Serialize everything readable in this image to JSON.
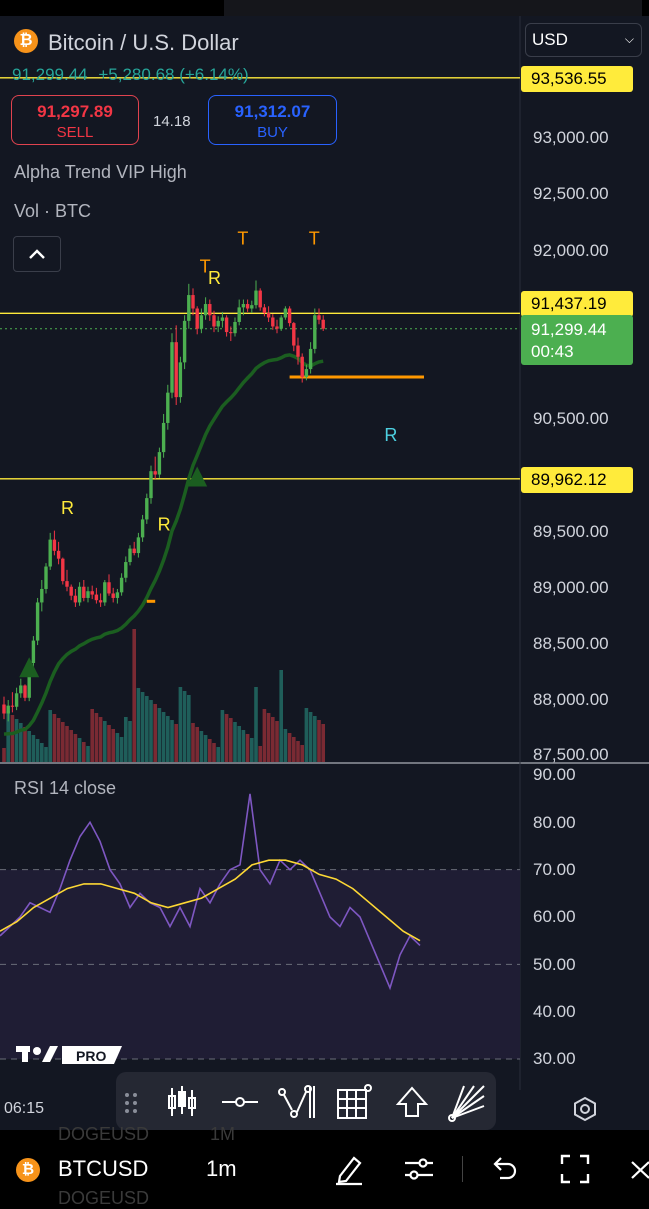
{
  "header": {
    "title": "Bitcoin / U.S. Dollar",
    "last_price": "91,299.44",
    "change": "+5,280.68 (+6.14%)",
    "currency": "USD",
    "logo_glyph": "₿"
  },
  "trade": {
    "sell_price": "91,297.89",
    "sell_label": "SELL",
    "spread": "14.18",
    "buy_price": "91,312.07",
    "buy_label": "BUY"
  },
  "indicators": {
    "alpha_trend": "Alpha Trend VIP High",
    "volume": "Vol · BTC",
    "rsi": "RSI 14 close"
  },
  "price_axis": {
    "tags": {
      "top_line": "93,536.55",
      "mid_line": "91,437.19",
      "low_line": "89,962.12",
      "current": "91,299.44",
      "countdown": "00:43"
    },
    "labels": [
      "93,000.00",
      "92,500.00",
      "92,000.00",
      "90,500.00",
      "89,500.00",
      "89,000.00",
      "88,500.00",
      "88,000.00",
      "87,500.00"
    ]
  },
  "rsi_axis": {
    "labels": [
      "90.00",
      "80.00",
      "70.00",
      "60.00",
      "50.00",
      "40.00",
      "30.00"
    ]
  },
  "time_axis": {
    "first": "06:15"
  },
  "signals": {
    "t": "T",
    "r": "R"
  },
  "branding": {
    "pro": "PRO"
  },
  "bottom_bar": {
    "symbol": "BTCUSD",
    "interval": "1m",
    "ghost_symbol_1": "DOGEUSD",
    "ghost_interval_1": "1M",
    "ghost_symbol_2": "DOGEUSD"
  },
  "colors": {
    "background": "#131722",
    "up": "#4caf50",
    "down": "#f23645",
    "levels": "#ffeb3b",
    "trend": "#1b5e20",
    "signal": "#ff9800",
    "rsi": "#7e57c2",
    "rsi_ma": "#fdd835"
  },
  "chart_data": {
    "type": "candlestick",
    "price_ylim": [
      87500,
      93700
    ],
    "levels": [
      93536.55,
      91437.19,
      89962.12
    ],
    "current": 91299.44,
    "ohlc": [
      [
        87950,
        88020,
        87820,
        87870
      ],
      [
        87870,
        87990,
        87800,
        87940
      ],
      [
        87940,
        88060,
        87880,
        87930
      ],
      [
        87930,
        88100,
        87900,
        88050
      ],
      [
        88050,
        88180,
        88010,
        88120
      ],
      [
        88120,
        88130,
        87980,
        88010
      ],
      [
        88010,
        88350,
        87980,
        88320
      ],
      [
        88320,
        88560,
        88280,
        88520
      ],
      [
        88520,
        88900,
        88480,
        88860
      ],
      [
        88860,
        89060,
        88780,
        88980
      ],
      [
        88980,
        89210,
        88940,
        89180
      ],
      [
        89180,
        89480,
        89150,
        89420
      ],
      [
        89420,
        89500,
        89280,
        89320
      ],
      [
        89320,
        89400,
        89200,
        89250
      ],
      [
        89250,
        89260,
        89020,
        89050
      ],
      [
        89050,
        89150,
        88960,
        89000
      ],
      [
        89000,
        89020,
        88880,
        88920
      ],
      [
        88920,
        88980,
        88820,
        88860
      ],
      [
        88860,
        89040,
        88830,
        89000
      ],
      [
        89000,
        89060,
        88870,
        88900
      ],
      [
        88900,
        89000,
        88860,
        88960
      ],
      [
        88960,
        89010,
        88890,
        88930
      ],
      [
        88930,
        88990,
        88850,
        88880
      ],
      [
        88880,
        88940,
        88820,
        88860
      ],
      [
        88860,
        89060,
        88830,
        89040
      ],
      [
        89040,
        89110,
        88920,
        88940
      ],
      [
        88940,
        88990,
        88860,
        88900
      ],
      [
        88900,
        88980,
        88850,
        88950
      ],
      [
        88950,
        89120,
        88920,
        89080
      ],
      [
        89080,
        89270,
        89040,
        89220
      ],
      [
        89220,
        89370,
        89190,
        89340
      ],
      [
        89340,
        89400,
        89280,
        89300
      ],
      [
        89300,
        89480,
        89260,
        89440
      ],
      [
        89440,
        89640,
        89400,
        89600
      ],
      [
        89600,
        89830,
        89560,
        89790
      ],
      [
        89790,
        90080,
        89740,
        90030
      ],
      [
        90030,
        90160,
        89960,
        90000
      ],
      [
        90000,
        90240,
        89970,
        90200
      ],
      [
        90200,
        90540,
        90150,
        90460
      ],
      [
        90460,
        90800,
        90400,
        90730
      ],
      [
        90730,
        91260,
        90680,
        91180
      ],
      [
        91180,
        91330,
        90620,
        90690
      ],
      [
        90690,
        91050,
        90640,
        91000
      ],
      [
        91000,
        91420,
        90940,
        91370
      ],
      [
        91370,
        91700,
        91300,
        91600
      ],
      [
        91600,
        91660,
        91420,
        91480
      ],
      [
        91480,
        91500,
        91250,
        91300
      ],
      [
        91300,
        91480,
        91260,
        91420
      ],
      [
        91420,
        91580,
        91380,
        91520
      ],
      [
        91520,
        91560,
        91370,
        91420
      ],
      [
        91420,
        91460,
        91270,
        91320
      ],
      [
        91320,
        91410,
        91270,
        91370
      ],
      [
        91370,
        91450,
        91310,
        91400
      ],
      [
        91400,
        91420,
        91230,
        91270
      ],
      [
        91270,
        91320,
        91190,
        91260
      ],
      [
        91260,
        91400,
        91230,
        91360
      ],
      [
        91360,
        91560,
        91330,
        91490
      ],
      [
        91490,
        91560,
        91420,
        91520
      ],
      [
        91520,
        91560,
        91450,
        91480
      ],
      [
        91480,
        91550,
        91440,
        91510
      ],
      [
        91510,
        91730,
        91480,
        91640
      ],
      [
        91640,
        91660,
        91460,
        91490
      ],
      [
        91490,
        91520,
        91410,
        91440
      ],
      [
        91440,
        91500,
        91360,
        91400
      ],
      [
        91400,
        91430,
        91290,
        91320
      ],
      [
        91320,
        91380,
        91260,
        91300
      ],
      [
        91300,
        91420,
        91280,
        91400
      ],
      [
        91400,
        91500,
        91380,
        91480
      ],
      [
        91480,
        91500,
        91320,
        91350
      ],
      [
        91350,
        91360,
        91100,
        91150
      ],
      [
        91150,
        91220,
        90980,
        91050
      ],
      [
        91050,
        91080,
        90820,
        90870
      ],
      [
        90870,
        90980,
        90840,
        90940
      ],
      [
        90940,
        91180,
        90900,
        91120
      ],
      [
        91120,
        91480,
        91080,
        91420
      ],
      [
        91420,
        91480,
        91340,
        91380
      ],
      [
        91380,
        91420,
        91280,
        91300
      ]
    ],
    "rsi": [
      56,
      58,
      60,
      63,
      62,
      61,
      66,
      72,
      77,
      80,
      76,
      70,
      67,
      62,
      65,
      63,
      62,
      58,
      62,
      58,
      66,
      63,
      67,
      70,
      71,
      86,
      70,
      67,
      72,
      70,
      72,
      70,
      65,
      60,
      58,
      62,
      60,
      55,
      50,
      45,
      52,
      56,
      54
    ],
    "rsi_ma": [
      57,
      59,
      62,
      64,
      66,
      67,
      67,
      66,
      65,
      63,
      62,
      63,
      64,
      66,
      68,
      71,
      72,
      72,
      71,
      69,
      68,
      66,
      63,
      60,
      57,
      55
    ],
    "rsi_levels": {
      "upper": 70,
      "mid": 50,
      "lower": 30
    },
    "rsi_ylim": [
      30,
      90
    ]
  }
}
